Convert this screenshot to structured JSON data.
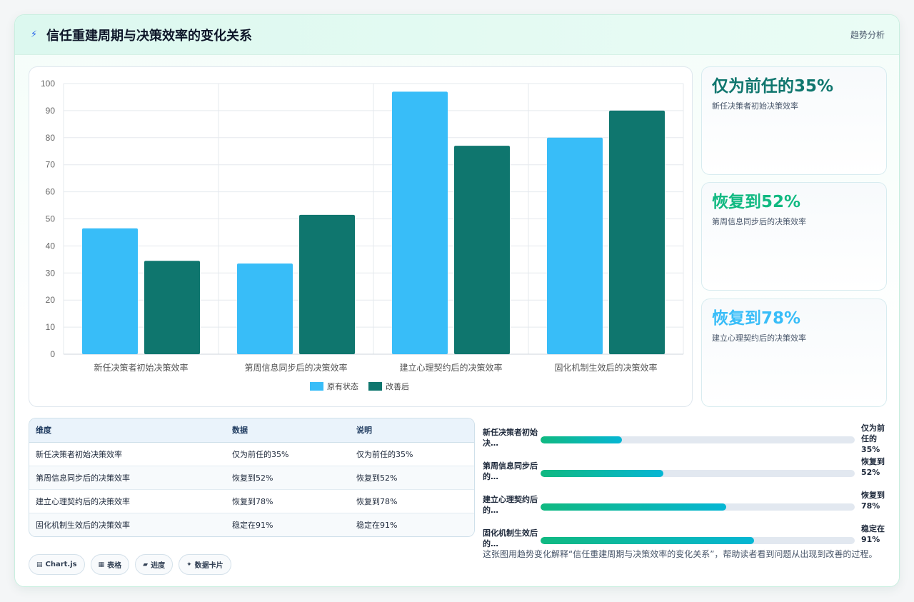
{
  "header": {
    "title": "信任重建周期与决策效率的变化关系",
    "link": "趋势分析",
    "icon": "lightning-icon"
  },
  "chart_data": {
    "type": "bar",
    "categories": [
      "新任决策者初始决策效率",
      "第周信息同步后的决策效率",
      "建立心理契约后的决策效率",
      "固化机制生效后的决策效率"
    ],
    "series": [
      {
        "name": "原有状态",
        "values": [
          46.5,
          33.5,
          97,
          80
        ],
        "color": "#38bdf8"
      },
      {
        "name": "改善后",
        "values": [
          34.5,
          51.5,
          77,
          90
        ],
        "color": "#0f766e"
      }
    ],
    "ylim": [
      0,
      100
    ],
    "yticks": [
      0,
      10,
      20,
      30,
      40,
      50,
      60,
      70,
      80,
      90,
      100
    ],
    "grid": true,
    "legend": "bottom"
  },
  "stats": [
    {
      "value": "仅为前任的35%",
      "label": "新任决策者初始决策效率",
      "color": "#0f766e"
    },
    {
      "value": "恢复到52%",
      "label": "第周信息同步后的决策效率",
      "color": "#10b981"
    },
    {
      "value": "恢复到78%",
      "label": "建立心理契约后的决策效率",
      "color": "#38bdf8"
    }
  ],
  "table": {
    "headers": [
      "维度",
      "数据",
      "说明"
    ],
    "rows": [
      [
        "新任决策者初始决策效率",
        "仅为前任的35%",
        "仅为前任的35%"
      ],
      [
        "第周信息同步后的决策效率",
        "恢复到52%",
        "恢复到52%"
      ],
      [
        "建立心理契约后的决策效率",
        "恢复到78%",
        "恢复到78%"
      ],
      [
        "固化机制生效后的决策效率",
        "稳定在91%",
        "稳定在91%"
      ]
    ]
  },
  "progress": [
    {
      "label": "新任决策者初始决…",
      "value": "仅为前任的35%",
      "pct": 26
    },
    {
      "label": "第周信息同步后的…",
      "value": "恢复到52%",
      "pct": 39
    },
    {
      "label": "建立心理契约后的…",
      "value": "恢复到78%",
      "pct": 59
    },
    {
      "label": "固化机制生效后的…",
      "value": "稳定在91%",
      "pct": 68
    }
  ],
  "chips": [
    {
      "icon": "▤",
      "label": "Chart.js"
    },
    {
      "icon": "▦",
      "label": "表格"
    },
    {
      "icon": "▰",
      "label": "进度"
    },
    {
      "icon": "✦",
      "label": "数据卡片"
    }
  ],
  "caption": "这张图用趋势变化解释“信任重建周期与决策效率的变化关系”，帮助读者看到问题从出现到改善的过程。"
}
